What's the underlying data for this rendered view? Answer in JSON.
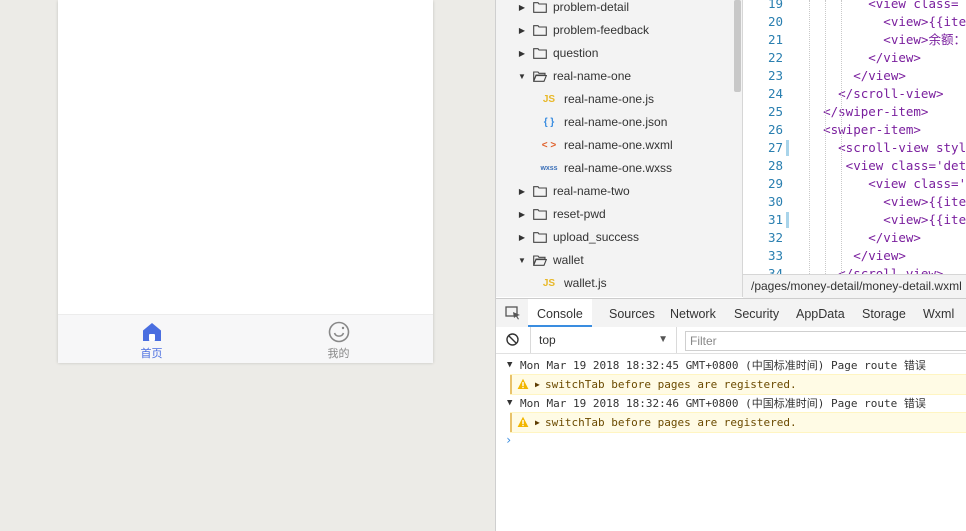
{
  "simulator": {
    "tabs": [
      {
        "label": "首页",
        "icon": "home-icon",
        "active": true,
        "color": "#4a6ee0"
      },
      {
        "label": "我的",
        "icon": "profile-icon",
        "active": false,
        "color": "#888888"
      }
    ]
  },
  "file_tree": {
    "items": [
      {
        "type": "folder",
        "name": "problem-detail",
        "expanded": false
      },
      {
        "type": "folder",
        "name": "problem-feedback",
        "expanded": false
      },
      {
        "type": "folder",
        "name": "question",
        "expanded": false
      },
      {
        "type": "folder",
        "name": "real-name-one",
        "expanded": true
      },
      {
        "type": "file",
        "name": "real-name-one.js",
        "icon_text": "JS",
        "icon_color": "#e8b829"
      },
      {
        "type": "file",
        "name": "real-name-one.json",
        "icon_text": "{ }",
        "icon_color": "#3a8de0"
      },
      {
        "type": "file",
        "name": "real-name-one.wxml",
        "icon_text": "< >",
        "icon_color": "#e0602a"
      },
      {
        "type": "file",
        "name": "real-name-one.wxss",
        "icon_text": "wxss",
        "icon_color": "#3a6fb8"
      },
      {
        "type": "folder",
        "name": "real-name-two",
        "expanded": false
      },
      {
        "type": "folder",
        "name": "reset-pwd",
        "expanded": false
      },
      {
        "type": "folder",
        "name": "upload_success",
        "expanded": false
      },
      {
        "type": "folder",
        "name": "wallet",
        "expanded": true
      },
      {
        "type": "file",
        "name": "wallet.js",
        "icon_text": "JS",
        "icon_color": "#e8b829"
      }
    ]
  },
  "editor": {
    "lines": [
      {
        "n": "19",
        "text": "          <view class=",
        "modified": false
      },
      {
        "n": "20",
        "text": "            <view>{{ite",
        "modified": false
      },
      {
        "n": "21",
        "text": "            <view>余额：",
        "modified": false
      },
      {
        "n": "22",
        "text": "          </view>",
        "modified": false
      },
      {
        "n": "23",
        "text": "        </view>",
        "modified": false
      },
      {
        "n": "24",
        "text": "      </scroll-view>",
        "modified": false
      },
      {
        "n": "25",
        "text": "    </swiper-item>",
        "modified": false
      },
      {
        "n": "26",
        "text": "    <swiper-item>",
        "modified": false
      },
      {
        "n": "27",
        "text": "      <scroll-view styl",
        "modified": true
      },
      {
        "n": "28",
        "text": "       <view class='det",
        "modified": false
      },
      {
        "n": "29",
        "text": "          <view class='",
        "modified": false
      },
      {
        "n": "30",
        "text": "            <view>{{ite",
        "modified": false
      },
      {
        "n": "31",
        "text": "            <view>{{ite",
        "modified": true
      },
      {
        "n": "32",
        "text": "          </view>",
        "modified": false
      },
      {
        "n": "33",
        "text": "        </view>",
        "modified": false
      },
      {
        "n": "34",
        "text": "      </scroll-view>",
        "modified": false
      }
    ],
    "file_path": "/pages/money-detail/money-detail.wxml"
  },
  "devtools_tabs": [
    {
      "label": "Console",
      "active": true
    },
    {
      "label": "Sources",
      "active": false
    },
    {
      "label": "Network",
      "active": false
    },
    {
      "label": "Security",
      "active": false
    },
    {
      "label": "AppData",
      "active": false
    },
    {
      "label": "Storage",
      "active": false
    },
    {
      "label": "Wxml",
      "active": false
    }
  ],
  "console": {
    "context": "top",
    "filter_placeholder": "Filter",
    "filter_value": "",
    "messages": [
      {
        "header": "Mon Mar 19 2018 18:32:45 GMT+0800 (中国标准时间) Page route 错误",
        "warning": "switchTab before pages are registered."
      },
      {
        "header": "Mon Mar 19 2018 18:32:46 GMT+0800 (中国标准时间) Page route 错误",
        "warning": "switchTab before pages are registered."
      }
    ],
    "prompt_symbol": "›"
  },
  "colors": {
    "accent_blue": "#4a6ee0",
    "warning_bg": "#fffbe5",
    "line_number": "#2a7fb0",
    "code_tag": "#7a1f9e"
  }
}
